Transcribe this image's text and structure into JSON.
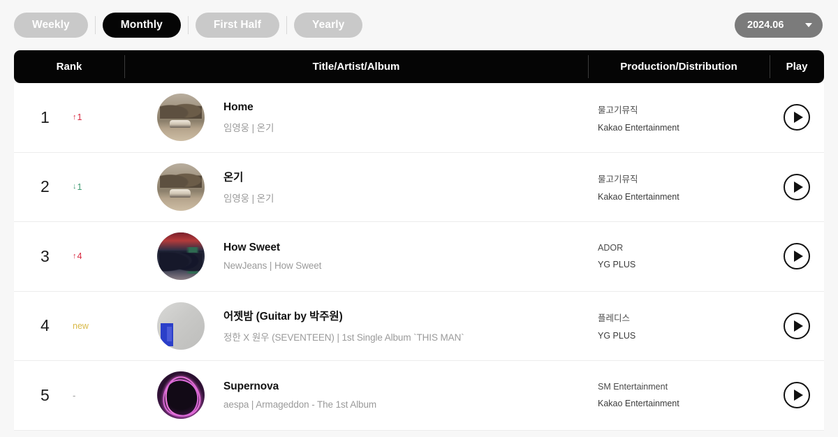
{
  "filters": {
    "tabs": [
      {
        "label": "Weekly",
        "active": false
      },
      {
        "label": "Monthly",
        "active": true
      },
      {
        "label": "First Half",
        "active": false
      },
      {
        "label": "Yearly",
        "active": false
      }
    ]
  },
  "date_selector": {
    "value": "2024.06",
    "icon": "chevron-down-icon"
  },
  "table": {
    "headers": {
      "rank": "Rank",
      "title": "Title/Artist/Album",
      "production": "Production/Distribution",
      "play": "Play"
    },
    "rows": [
      {
        "rank": "1",
        "change_type": "up",
        "change_label": "1",
        "change_arrow": "↑",
        "title": "Home",
        "subtitle": "임영웅 | 온기",
        "production": "물고기뮤직",
        "distribution": "Kakao Entertainment",
        "art": "art-home",
        "play_icon": "play-icon"
      },
      {
        "rank": "2",
        "change_type": "down",
        "change_label": "1",
        "change_arrow": "↓",
        "title": "온기",
        "subtitle": "임영웅 | 온기",
        "production": "물고기뮤직",
        "distribution": "Kakao Entertainment",
        "art": "art-home",
        "play_icon": "play-icon"
      },
      {
        "rank": "3",
        "change_type": "up",
        "change_label": "4",
        "change_arrow": "↑",
        "title": "How Sweet",
        "subtitle": "NewJeans | How Sweet",
        "production": "ADOR",
        "distribution": "YG PLUS",
        "art": "art-howsweet",
        "play_icon": "play-icon"
      },
      {
        "rank": "4",
        "change_type": "new",
        "change_label": "new",
        "change_arrow": "",
        "title": "어젯밤 (Guitar by 박주원)",
        "subtitle": "정한 X 원우 (SEVENTEEN) | 1st Single Album `THIS MAN`",
        "production": "플레디스",
        "distribution": "YG PLUS",
        "art": "art-guitar",
        "play_icon": "play-icon"
      },
      {
        "rank": "5",
        "change_type": "same",
        "change_label": "-",
        "change_arrow": "",
        "title": "Supernova",
        "subtitle": "aespa | Armageddon - The 1st Album",
        "production": "SM Entertainment",
        "distribution": "Kakao Entertainment",
        "art": "art-supernova",
        "play_icon": "play-icon"
      }
    ]
  },
  "colors": {
    "accent_up": "#d7263d",
    "accent_down": "#3d9970",
    "accent_new": "#d8b948",
    "header_bg": "#050505",
    "tab_inactive": "#c9c9c9",
    "date_bg": "#7b7b7b"
  }
}
